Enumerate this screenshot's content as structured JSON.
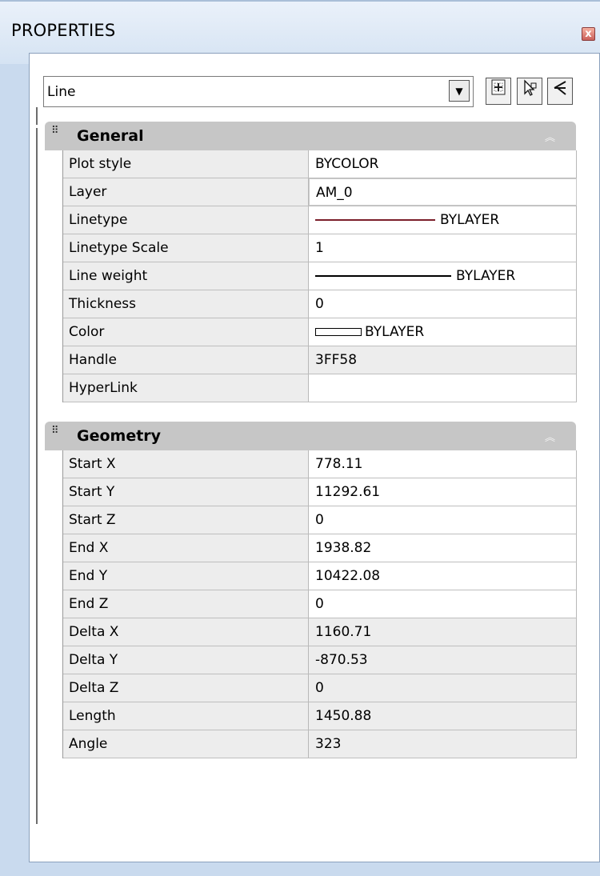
{
  "window": {
    "title": "PROPERTIES",
    "close_glyph": "x"
  },
  "selector": {
    "value": "Line",
    "arrow_glyph": "▼"
  },
  "toolbar": {
    "quick_select": "quick-select-icon",
    "select_objects": "select-objects-icon",
    "toggle_pickadd": "toggle-pickadd-icon"
  },
  "sections": [
    {
      "title": "General",
      "rows": [
        {
          "name": "Plot style",
          "value": "BYCOLOR",
          "readonly": false
        },
        {
          "name": "Layer",
          "value": "AM_0",
          "readonly": false
        },
        {
          "name": "Linetype",
          "value": "BYLAYER",
          "readonly": false,
          "sample": "line",
          "sample_color": "#7b1f2a"
        },
        {
          "name": "Linetype Scale",
          "value": "1",
          "readonly": false
        },
        {
          "name": "Line weight",
          "value": "BYLAYER",
          "readonly": false,
          "sample": "line",
          "sample_color": "#000000"
        },
        {
          "name": "Thickness",
          "value": "0",
          "readonly": false
        },
        {
          "name": "Color",
          "value": "BYLAYER",
          "readonly": false,
          "sample": "box"
        },
        {
          "name": "Handle",
          "value": "3FF58",
          "readonly": true
        },
        {
          "name": "HyperLink",
          "value": "",
          "readonly": false
        }
      ]
    },
    {
      "title": "Geometry",
      "rows": [
        {
          "name": "Start X",
          "value": "778.11",
          "readonly": false
        },
        {
          "name": "Start Y",
          "value": "11292.61",
          "readonly": false
        },
        {
          "name": "Start Z",
          "value": "0",
          "readonly": false
        },
        {
          "name": "End X",
          "value": "1938.82",
          "readonly": false
        },
        {
          "name": "End Y",
          "value": "10422.08",
          "readonly": false
        },
        {
          "name": "End Z",
          "value": "0",
          "readonly": false
        },
        {
          "name": "Delta X",
          "value": "1160.71",
          "readonly": true
        },
        {
          "name": "Delta Y",
          "value": "-870.53",
          "readonly": true
        },
        {
          "name": "Delta Z",
          "value": "0",
          "readonly": true
        },
        {
          "name": "Length",
          "value": "1450.88",
          "readonly": true
        },
        {
          "name": "Angle",
          "value": "323",
          "readonly": true
        }
      ]
    }
  ]
}
